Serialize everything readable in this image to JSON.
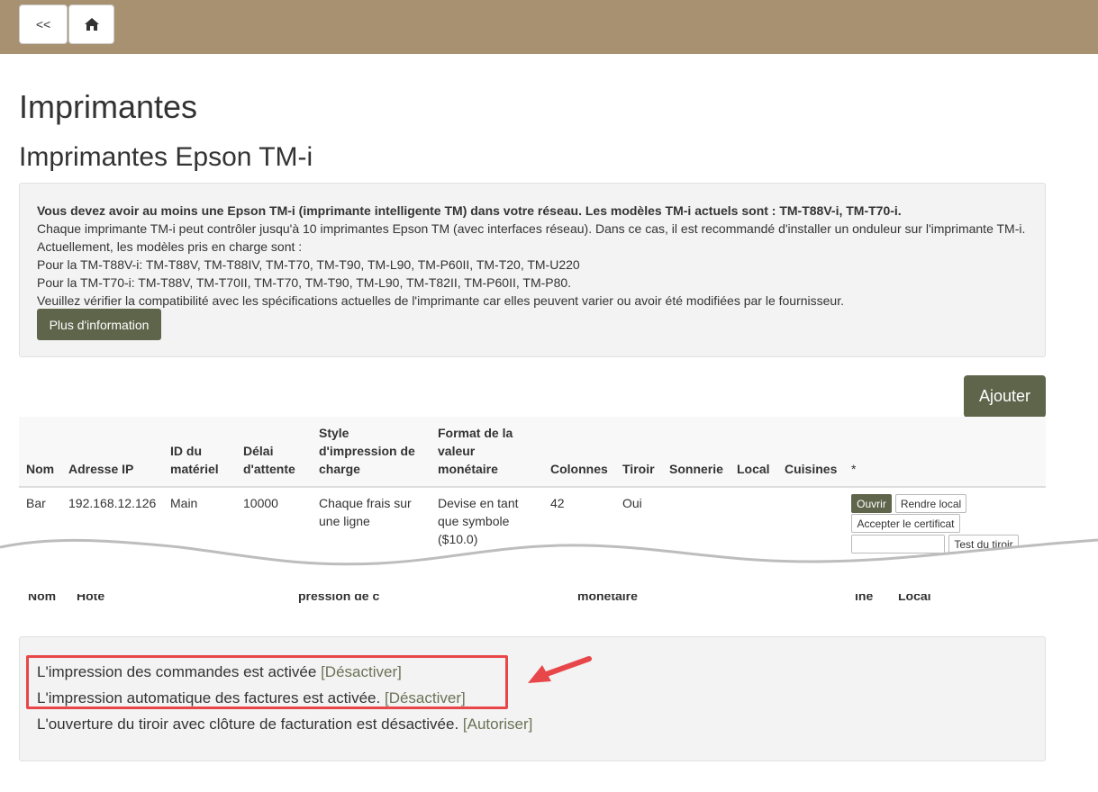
{
  "nav": {
    "back_label": "<<",
    "home_icon": "home-icon"
  },
  "page_title": "Imprimantes",
  "section_title": "Imprimantes Epson TM-i",
  "info": {
    "line1": "Vous devez avoir au moins une Epson TM-i (imprimante intelligente TM) dans votre réseau. Les modèles TM-i actuels sont : TM-T88V-i, TM-T70-i.",
    "line2": "Chaque imprimante TM-i peut contrôler jusqu'à 10 imprimantes Epson TM (avec interfaces réseau). Dans ce cas, il est recommandé d'installer un onduleur sur l'imprimante TM-i.",
    "line3": "Actuellement, les modèles pris en charge sont :",
    "line4": "Pour la TM-T88V-i: TM-T88V, TM-T88IV, TM-T70, TM-T90, TM-L90, TM-P60II, TM-T20, TM-U220",
    "line5": "Pour la TM-T70-i: TM-T88V, TM-T70II, TM-T70, TM-T90, TM-L90, TM-T82II, TM-P60II, TM-P80.",
    "line6": "Veuillez vérifier la compatibilité avec les spécifications actuelles de l'imprimante car elles peuvent varier ou avoir été modifiées par le fournisseur.",
    "more_button": "Plus d'information"
  },
  "add_button": "Ajouter",
  "table": {
    "headers": {
      "name": "Nom",
      "ip": "Adresse IP",
      "device_id_1": "ID du",
      "device_id_2": "matériel",
      "timeout_1": "Délai",
      "timeout_2": "d'attente",
      "style_1": "Style",
      "style_2": "d'impression de",
      "style_3": "charge",
      "format_1": "Format de la",
      "format_2": "valeur",
      "format_3": "monétaire",
      "columns": "Colonnes",
      "drawer": "Tiroir",
      "bell": "Sonnerie",
      "local": "Local",
      "kitchens": "Cuisines",
      "star": "*"
    },
    "row": {
      "name": "Bar",
      "ip": "192.168.12.126",
      "device_id": "Main",
      "timeout": "10000",
      "style_1": "Chaque frais sur",
      "style_2": "une ligne",
      "format_1": "Devise en tant",
      "format_2": "que symbole",
      "format_3": "($10.0)",
      "columns": "42",
      "drawer": "Oui",
      "actions": {
        "open": "Ouvrir",
        "make_local": "Rendre local",
        "accept_cert": "Accepter le certificat",
        "test_drawer": "Test du tiroir"
      }
    }
  },
  "second_table_fragments": {
    "h1": "Nom",
    "h2": "Hôte",
    "h3": "pression de c",
    "h4": "monétaire",
    "h5": "ine",
    "h6": "Local"
  },
  "status": {
    "orders_text": "L'impression des commandes est activée",
    "orders_link": "[Désactiver]",
    "invoices_text": "L'impression automatique des factures est activée.",
    "invoices_link": "[Désactiver]",
    "drawer_text": "L'ouverture du tiroir avec clôture de facturation est désactivée.",
    "drawer_link": "[Autoriser]"
  },
  "colors": {
    "topbar": "#a89171",
    "accent_button": "#5e654b",
    "highlight": "#e8474a"
  }
}
